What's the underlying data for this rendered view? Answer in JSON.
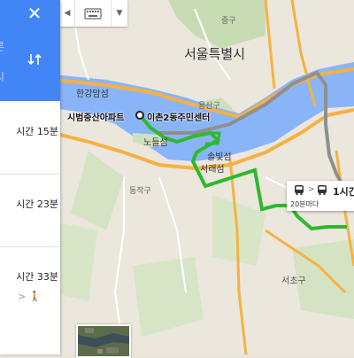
{
  "map": {
    "city_label": "서울특별시",
    "labels": {
      "junggu": "중구",
      "hangang_bridge": "한강맘섬",
      "yongsangu": "용산구",
      "nodeulseom": "노들섬",
      "dongjakgu": "동작구",
      "seorae": "서래섬",
      "sevit": "솔빛섬",
      "seochogu": "서초구"
    },
    "origin_label": "시범중산아파트",
    "destination_label": "이촌2동주민센터"
  },
  "panel": {
    "origin_partial": "른",
    "destination_partial": "시",
    "routes": [
      {
        "time": "시간 15분"
      },
      {
        "time": "시간 23분"
      },
      {
        "time": "시간 33분",
        "mode": "> 🚶"
      }
    ]
  },
  "transit_card": {
    "time": "1시간",
    "frequency": "20분마다"
  },
  "colors": {
    "panel_blue": "#4285f4",
    "route_green": "#2db92d",
    "river_blue": "#8ab4f8",
    "road_orange": "#f6b142"
  }
}
